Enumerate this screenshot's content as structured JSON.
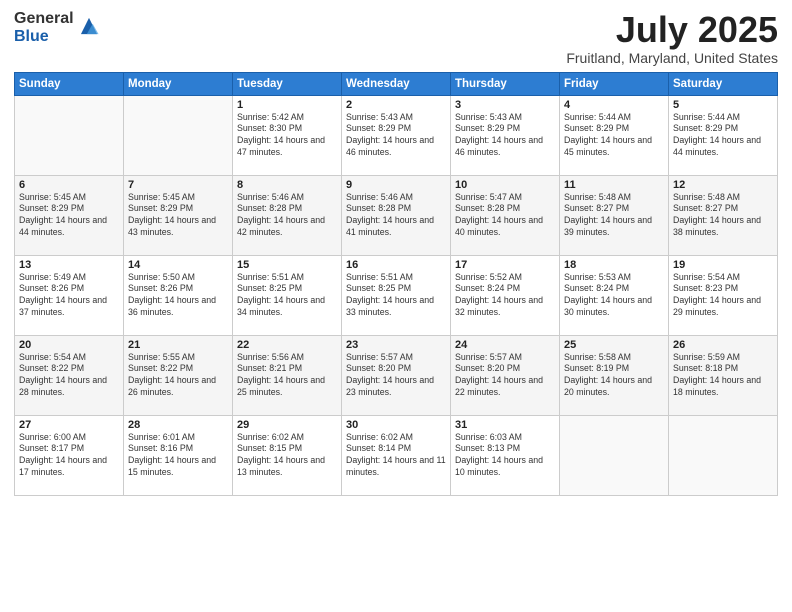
{
  "logo": {
    "general": "General",
    "blue": "Blue"
  },
  "title": "July 2025",
  "subtitle": "Fruitland, Maryland, United States",
  "headers": [
    "Sunday",
    "Monday",
    "Tuesday",
    "Wednesday",
    "Thursday",
    "Friday",
    "Saturday"
  ],
  "weeks": [
    [
      {
        "day": "",
        "sunrise": "",
        "sunset": "",
        "daylight": ""
      },
      {
        "day": "",
        "sunrise": "",
        "sunset": "",
        "daylight": ""
      },
      {
        "day": "1",
        "sunrise": "Sunrise: 5:42 AM",
        "sunset": "Sunset: 8:30 PM",
        "daylight": "Daylight: 14 hours and 47 minutes."
      },
      {
        "day": "2",
        "sunrise": "Sunrise: 5:43 AM",
        "sunset": "Sunset: 8:29 PM",
        "daylight": "Daylight: 14 hours and 46 minutes."
      },
      {
        "day": "3",
        "sunrise": "Sunrise: 5:43 AM",
        "sunset": "Sunset: 8:29 PM",
        "daylight": "Daylight: 14 hours and 46 minutes."
      },
      {
        "day": "4",
        "sunrise": "Sunrise: 5:44 AM",
        "sunset": "Sunset: 8:29 PM",
        "daylight": "Daylight: 14 hours and 45 minutes."
      },
      {
        "day": "5",
        "sunrise": "Sunrise: 5:44 AM",
        "sunset": "Sunset: 8:29 PM",
        "daylight": "Daylight: 14 hours and 44 minutes."
      }
    ],
    [
      {
        "day": "6",
        "sunrise": "Sunrise: 5:45 AM",
        "sunset": "Sunset: 8:29 PM",
        "daylight": "Daylight: 14 hours and 44 minutes."
      },
      {
        "day": "7",
        "sunrise": "Sunrise: 5:45 AM",
        "sunset": "Sunset: 8:29 PM",
        "daylight": "Daylight: 14 hours and 43 minutes."
      },
      {
        "day": "8",
        "sunrise": "Sunrise: 5:46 AM",
        "sunset": "Sunset: 8:28 PM",
        "daylight": "Daylight: 14 hours and 42 minutes."
      },
      {
        "day": "9",
        "sunrise": "Sunrise: 5:46 AM",
        "sunset": "Sunset: 8:28 PM",
        "daylight": "Daylight: 14 hours and 41 minutes."
      },
      {
        "day": "10",
        "sunrise": "Sunrise: 5:47 AM",
        "sunset": "Sunset: 8:28 PM",
        "daylight": "Daylight: 14 hours and 40 minutes."
      },
      {
        "day": "11",
        "sunrise": "Sunrise: 5:48 AM",
        "sunset": "Sunset: 8:27 PM",
        "daylight": "Daylight: 14 hours and 39 minutes."
      },
      {
        "day": "12",
        "sunrise": "Sunrise: 5:48 AM",
        "sunset": "Sunset: 8:27 PM",
        "daylight": "Daylight: 14 hours and 38 minutes."
      }
    ],
    [
      {
        "day": "13",
        "sunrise": "Sunrise: 5:49 AM",
        "sunset": "Sunset: 8:26 PM",
        "daylight": "Daylight: 14 hours and 37 minutes."
      },
      {
        "day": "14",
        "sunrise": "Sunrise: 5:50 AM",
        "sunset": "Sunset: 8:26 PM",
        "daylight": "Daylight: 14 hours and 36 minutes."
      },
      {
        "day": "15",
        "sunrise": "Sunrise: 5:51 AM",
        "sunset": "Sunset: 8:25 PM",
        "daylight": "Daylight: 14 hours and 34 minutes."
      },
      {
        "day": "16",
        "sunrise": "Sunrise: 5:51 AM",
        "sunset": "Sunset: 8:25 PM",
        "daylight": "Daylight: 14 hours and 33 minutes."
      },
      {
        "day": "17",
        "sunrise": "Sunrise: 5:52 AM",
        "sunset": "Sunset: 8:24 PM",
        "daylight": "Daylight: 14 hours and 32 minutes."
      },
      {
        "day": "18",
        "sunrise": "Sunrise: 5:53 AM",
        "sunset": "Sunset: 8:24 PM",
        "daylight": "Daylight: 14 hours and 30 minutes."
      },
      {
        "day": "19",
        "sunrise": "Sunrise: 5:54 AM",
        "sunset": "Sunset: 8:23 PM",
        "daylight": "Daylight: 14 hours and 29 minutes."
      }
    ],
    [
      {
        "day": "20",
        "sunrise": "Sunrise: 5:54 AM",
        "sunset": "Sunset: 8:22 PM",
        "daylight": "Daylight: 14 hours and 28 minutes."
      },
      {
        "day": "21",
        "sunrise": "Sunrise: 5:55 AM",
        "sunset": "Sunset: 8:22 PM",
        "daylight": "Daylight: 14 hours and 26 minutes."
      },
      {
        "day": "22",
        "sunrise": "Sunrise: 5:56 AM",
        "sunset": "Sunset: 8:21 PM",
        "daylight": "Daylight: 14 hours and 25 minutes."
      },
      {
        "day": "23",
        "sunrise": "Sunrise: 5:57 AM",
        "sunset": "Sunset: 8:20 PM",
        "daylight": "Daylight: 14 hours and 23 minutes."
      },
      {
        "day": "24",
        "sunrise": "Sunrise: 5:57 AM",
        "sunset": "Sunset: 8:20 PM",
        "daylight": "Daylight: 14 hours and 22 minutes."
      },
      {
        "day": "25",
        "sunrise": "Sunrise: 5:58 AM",
        "sunset": "Sunset: 8:19 PM",
        "daylight": "Daylight: 14 hours and 20 minutes."
      },
      {
        "day": "26",
        "sunrise": "Sunrise: 5:59 AM",
        "sunset": "Sunset: 8:18 PM",
        "daylight": "Daylight: 14 hours and 18 minutes."
      }
    ],
    [
      {
        "day": "27",
        "sunrise": "Sunrise: 6:00 AM",
        "sunset": "Sunset: 8:17 PM",
        "daylight": "Daylight: 14 hours and 17 minutes."
      },
      {
        "day": "28",
        "sunrise": "Sunrise: 6:01 AM",
        "sunset": "Sunset: 8:16 PM",
        "daylight": "Daylight: 14 hours and 15 minutes."
      },
      {
        "day": "29",
        "sunrise": "Sunrise: 6:02 AM",
        "sunset": "Sunset: 8:15 PM",
        "daylight": "Daylight: 14 hours and 13 minutes."
      },
      {
        "day": "30",
        "sunrise": "Sunrise: 6:02 AM",
        "sunset": "Sunset: 8:14 PM",
        "daylight": "Daylight: 14 hours and 11 minutes."
      },
      {
        "day": "31",
        "sunrise": "Sunrise: 6:03 AM",
        "sunset": "Sunset: 8:13 PM",
        "daylight": "Daylight: 14 hours and 10 minutes."
      },
      {
        "day": "",
        "sunrise": "",
        "sunset": "",
        "daylight": ""
      },
      {
        "day": "",
        "sunrise": "",
        "sunset": "",
        "daylight": ""
      }
    ]
  ]
}
